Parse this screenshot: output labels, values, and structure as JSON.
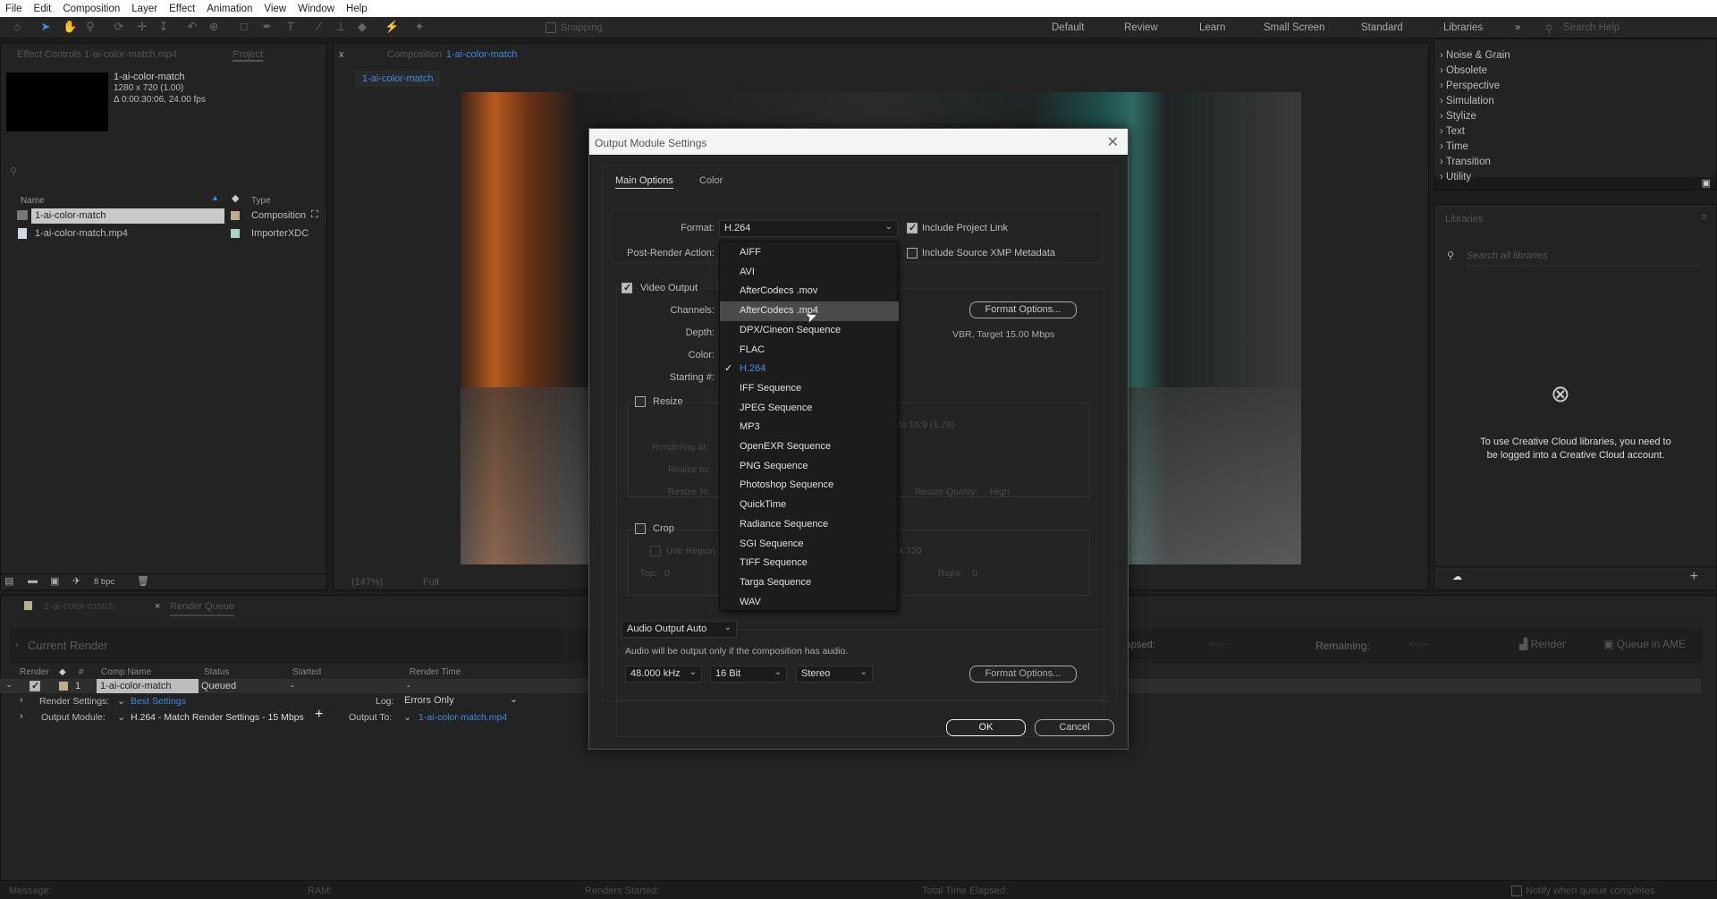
{
  "menu": [
    "File",
    "Edit",
    "Composition",
    "Layer",
    "Effect",
    "Animation",
    "View",
    "Window",
    "Help"
  ],
  "toolbar": {
    "snapping": "Snapping",
    "workspaces": [
      "Default",
      "Review",
      "Learn",
      "Small Screen",
      "Standard",
      "Libraries"
    ],
    "search_placeholder": "Search Help"
  },
  "left_panel": {
    "tab_effect_controls": "Effect Controls 1-ai-color-match.mp4",
    "tab_project": "Project",
    "comp_name": "1-ai-color-match",
    "comp_res": "1280 x 720 (1.00)",
    "comp_duration": "Δ 0:00:30:06, 24.00 fps",
    "col_name": "Name",
    "col_type": "Type",
    "items": [
      {
        "name": "1-ai-color-match",
        "type": "Composition",
        "label_color": "#b9ae8e"
      },
      {
        "name": "1-ai-color-match.mp4",
        "type": "ImporterXDC",
        "label_color": "#a8d4c8"
      }
    ],
    "bpc": "8 bpc"
  },
  "viewer": {
    "tab_prefix": "Composition",
    "tab_name": "1-ai-color-match",
    "subtab": "1-ai-color-match",
    "zoom": "(147%)",
    "resolution": "Full"
  },
  "effects_list": [
    "Noise & Grain",
    "Obsolete",
    "Perspective",
    "Simulation",
    "Stylize",
    "Text",
    "Time",
    "Transition",
    "Utility"
  ],
  "libraries": {
    "title": "Libraries",
    "search_placeholder": "Search all libraries",
    "message": "To use Creative Cloud libraries, you need to be logged into a Creative Cloud account."
  },
  "dialog": {
    "title": "Output Module Settings",
    "tabs": [
      "Main Options",
      "Color"
    ],
    "format_label": "Format:",
    "format_value": "H.264",
    "post_render_label": "Post-Render Action:",
    "include_project_link": "Include Project Link",
    "include_project_link_checked": true,
    "include_xmp": "Include Source XMP Metadata",
    "include_xmp_checked": false,
    "video_output": "Video Output",
    "video_output_checked": true,
    "channels_label": "Channels:",
    "depth_label": "Depth:",
    "color_label": "Color:",
    "starting_label": "Starting #:",
    "format_options": "Format Options...",
    "vbr_text": "VBR, Target 15.00 Mbps",
    "resize": "Resize",
    "rendering_at": "Rendering at:",
    "resize_to": "Resize to:",
    "resize_pct": "Resize %:",
    "aspect_text": "to 16:9 (1.78)",
    "resize_quality": "Resize Quality:",
    "resize_quality_value": "High",
    "crop": "Crop",
    "use_region": "Use Region",
    "crop_size": "x 720",
    "top_label": "Top:",
    "top_value": "0",
    "right_label": "Right:",
    "right_value": "0",
    "format_options_list": [
      "AIFF",
      "AVI",
      "AfterCodecs .mov",
      "AfterCodecs .mp4",
      "DPX/Cineon Sequence",
      "FLAC",
      "H.264",
      "IFF Sequence",
      "JPEG Sequence",
      "MP3",
      "OpenEXR Sequence",
      "PNG Sequence",
      "Photoshop Sequence",
      "QuickTime",
      "Radiance Sequence",
      "SGI Sequence",
      "TIFF Sequence",
      "Targa Sequence",
      "WAV"
    ],
    "hovered_option": "AfterCodecs .mp4",
    "selected_option": "H.264",
    "audio_output": "Audio Output Auto",
    "audio_note": "Audio will be output only if the composition has audio.",
    "sample_rate": "48.000 kHz",
    "bit_depth": "16 Bit",
    "channels_audio": "Stereo",
    "audio_format_options": "Format Options...",
    "ok": "OK",
    "cancel": "Cancel"
  },
  "render_queue": {
    "tab_comp": "1-ai-color-match",
    "tab_rq": "Render Queue",
    "current_render": "Current Render",
    "elapsed": "Elapsed:",
    "elapsed_value": "-:-:-:-",
    "remaining": "Remaining:",
    "remaining_value": "-:-:-:-",
    "render_btn": "Render",
    "queue_ame": "Queue in AME",
    "headers": [
      "Render",
      "#",
      "Comp Name",
      "Status",
      "Started",
      "Render Time"
    ],
    "row": {
      "num": "1",
      "comp": "1-ai-color-match",
      "status": "Queued",
      "started": "-",
      "render_time": "-"
    },
    "render_settings_label": "Render Settings:",
    "render_settings_value": "Best Settings",
    "log_label": "Log:",
    "log_value": "Errors Only",
    "output_module_label": "Output Module:",
    "output_module_value": "H.264 - Match Render Settings - 15 Mbps",
    "output_to_label": "Output To:",
    "output_to_value": "1-ai-color-match.mp4"
  },
  "status_bar": {
    "message": "Message:",
    "ram": "RAM:",
    "renders_started": "Renders Started:",
    "total_time": "Total Time Elapsed:",
    "notify": "Notify when queue completes"
  }
}
